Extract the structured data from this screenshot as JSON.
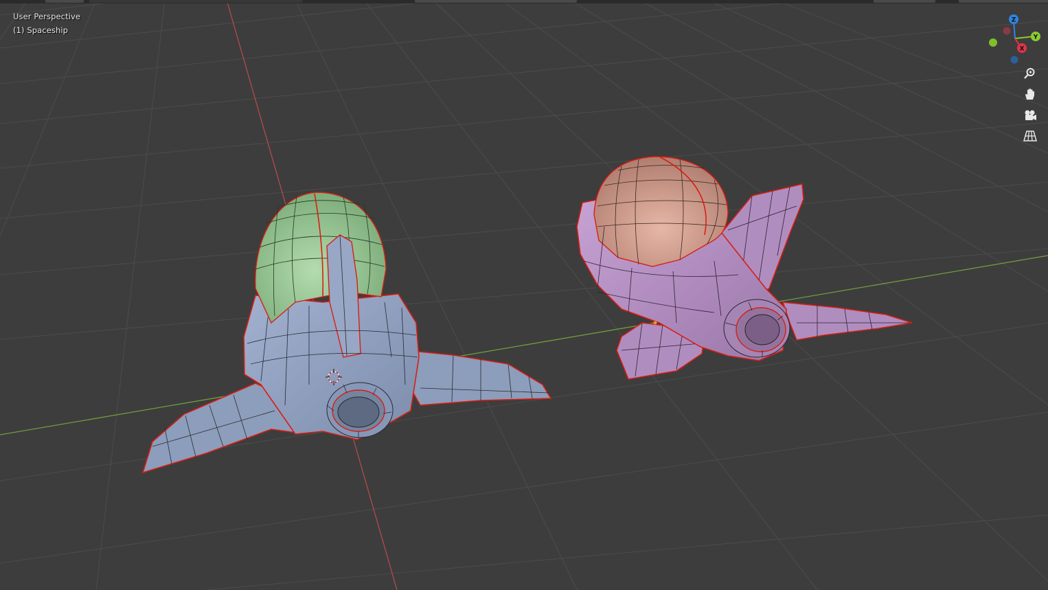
{
  "viewport": {
    "view_name": "User Perspective",
    "object_name": "(1) Spaceship"
  },
  "gizmo": {
    "z_label": "Z",
    "y_label": "Y",
    "x_label": "X",
    "colors": {
      "x": "#e0344c",
      "y": "#8bcc2e",
      "z": "#2f84e3"
    }
  },
  "nav_icons": [
    "zoom-icon",
    "hand-icon",
    "camera-icon",
    "grid-view-icon"
  ],
  "colors": {
    "background": "#3d3d3d",
    "grid": "#4a4a4a",
    "x_axis": "#b44a4a",
    "y_axis": "#6c9a3a",
    "ship_left_body": "#8c9cbc",
    "ship_left_dome": "#8fbf8d",
    "ship_right_body": "#b791c5",
    "ship_right_dome": "#c99485",
    "seam": "#d81e12"
  }
}
